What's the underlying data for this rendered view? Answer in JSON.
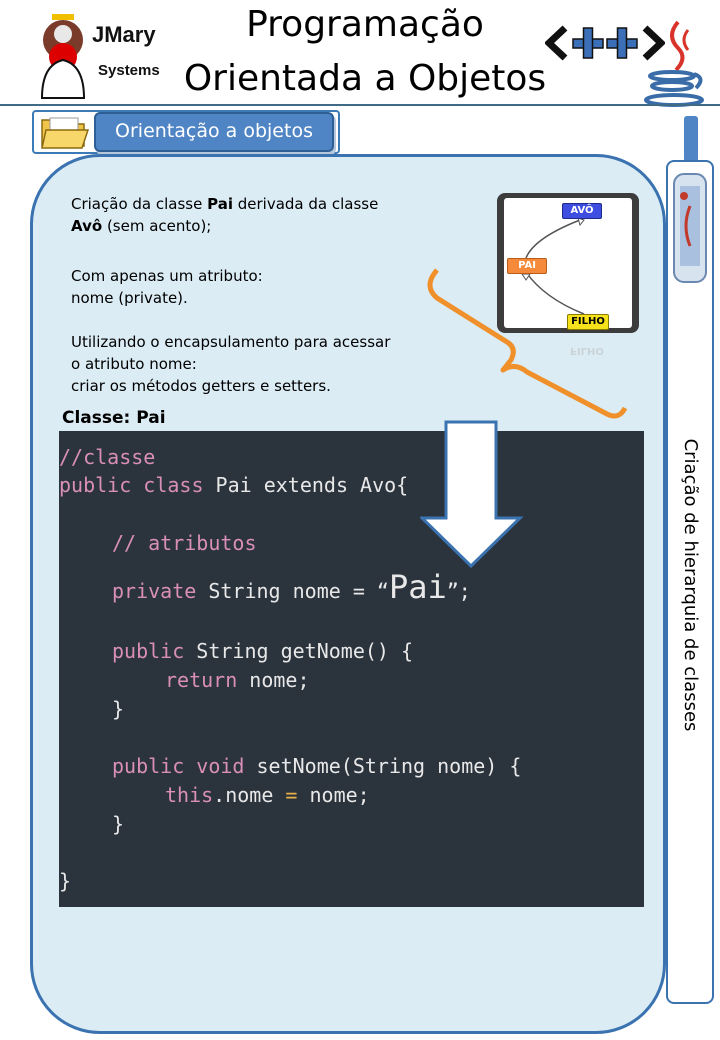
{
  "header": {
    "logo_name": "JMary",
    "logo_sub": "Systems",
    "title_line1": "Programação",
    "title_line2": "Orientada a Objetos"
  },
  "section": {
    "title": "Orientação a objetos"
  },
  "sidebar": {
    "label": "Criação de hierarquia de classes"
  },
  "description": {
    "p1_a": "Criação da classe ",
    "p1_b": "Pai",
    "p1_c": " derivada da classe",
    "p1_d": "Avô",
    "p1_e": " (sem acento);",
    "p2_line1": "Com apenas um atributo:",
    "p2_line2": "nome (private).",
    "p3_line1": "Utilizando o encapsulamento para acessar",
    "p3_line2": "o atributo nome:",
    "p3_line3": "criar os métodos getters e setters."
  },
  "diagram": {
    "node_top": "AVÔ",
    "node_mid": "PAI",
    "node_bottom": "FILHO"
  },
  "class_label": "Classe: Pai",
  "code": {
    "l1": "//classe",
    "l2_kw": "public class",
    "l2_rest": " Pai extends Avo{",
    "l3": "// atributos",
    "l4_kw": "private",
    "l4_a": " String nome = “",
    "l4_big": "Pai",
    "l4_end": "”;",
    "l5_kw": "public",
    "l5_rest": " String getNome() {",
    "l6_kw": "return",
    "l6_rest": " nome;",
    "l7": "}",
    "l8_kw": "public void",
    "l8_rest": " setNome(String nome) {",
    "l9_kw": "this",
    "l9_a": ".nome ",
    "l9_op": "=",
    "l9_b": " nome;",
    "l10": "}",
    "l11": "}"
  },
  "colors": {
    "panel_bg": "#dbecf5",
    "border_blue": "#3a73b0",
    "banner_blue": "#4f85c4",
    "code_bg": "#2b333d",
    "keyword_pink": "#d98fb7",
    "brace_orange": "#f0902a"
  },
  "icons": [
    "duke-mascot-icon",
    "cpp-plus-icon",
    "java-cup-icon",
    "folder-icon",
    "newspaper-scroll-icon",
    "arrow-down-icon",
    "curly-brace-icon"
  ]
}
